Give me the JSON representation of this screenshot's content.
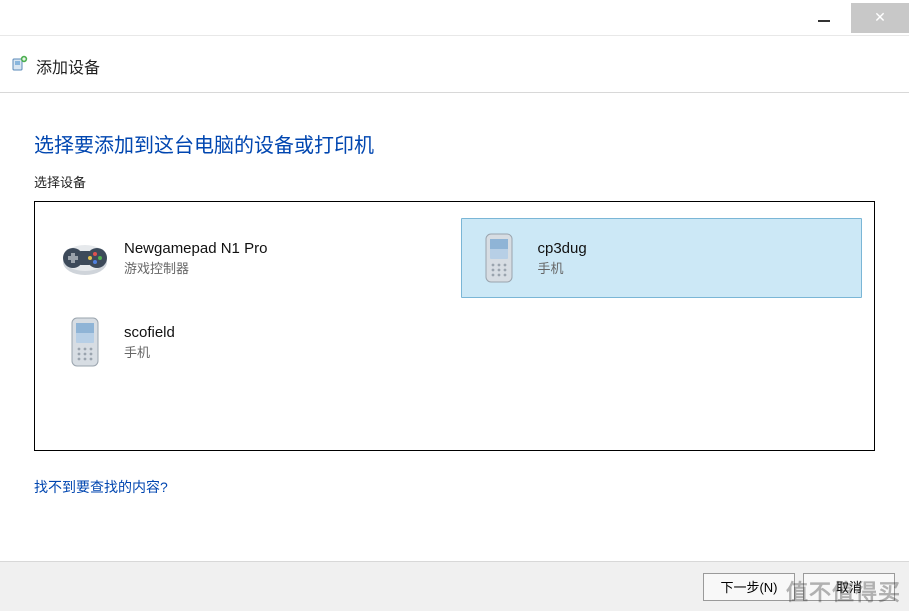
{
  "window": {
    "title": "添加设备"
  },
  "main": {
    "heading": "选择要添加到这台电脑的设备或打印机",
    "sub_label": "选择设备",
    "help_link": "找不到要查找的内容?"
  },
  "devices": [
    {
      "name": "Newgamepad N1 Pro",
      "type": "游戏控制器",
      "icon": "gamepad",
      "selected": false
    },
    {
      "name": "cp3dug",
      "type": "手机",
      "icon": "phone",
      "selected": true
    },
    {
      "name": "scofield",
      "type": "手机",
      "icon": "phone",
      "selected": false
    }
  ],
  "footer": {
    "next": "下一步(N)",
    "cancel": "取消"
  },
  "watermark": "值不值得买"
}
